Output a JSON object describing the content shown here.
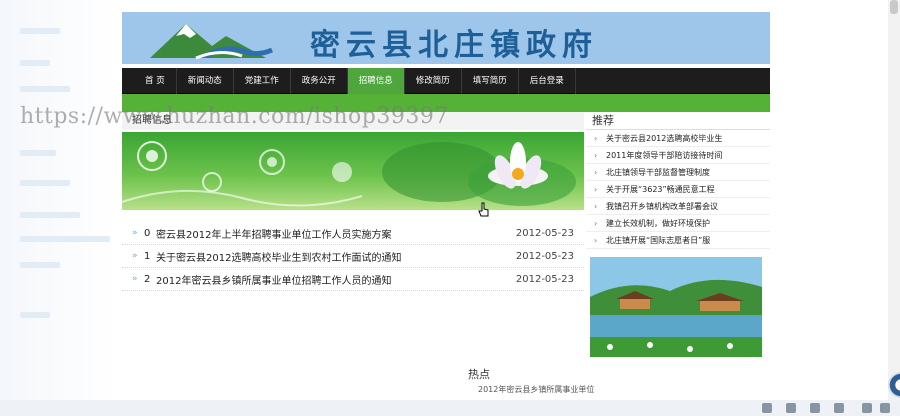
{
  "site_title": "密云县北庄镇政府",
  "nav": [
    {
      "label": "首 页",
      "active": false
    },
    {
      "label": "新闻动态",
      "active": false
    },
    {
      "label": "党建工作",
      "active": false
    },
    {
      "label": "政务公开",
      "active": false
    },
    {
      "label": "招聘信息",
      "active": true
    },
    {
      "label": "修改简历",
      "active": false
    },
    {
      "label": "填写简历",
      "active": false
    },
    {
      "label": "后台登录",
      "active": false
    }
  ],
  "main": {
    "section_title": "招聘信息",
    "news": [
      {
        "index": "0",
        "title": "密云县2012年上半年招聘事业单位工作人员实施方案",
        "date": "2012-05-23"
      },
      {
        "index": "1",
        "title": "关于密云县2012选聘高校毕业生到农村工作面试的通知",
        "date": "2012-05-23"
      },
      {
        "index": "2",
        "title": "2012年密云县乡镇所属事业单位招聘工作人员的通知",
        "date": "2012-05-23"
      }
    ]
  },
  "side": {
    "recommend_title": "推荐",
    "recommend_items": [
      "关于密云县2012选聘高校毕业生",
      "2011年度领导干部陪访接待时间",
      "北庄镇领导干部监督管理制度",
      "关于开展“3623”畅通民意工程",
      "我镇召开乡镇机构改革部署会议",
      "建立长效机制，做好环境保护",
      "北庄镇开展“国际志愿者日”服"
    ],
    "hot_title": "热点",
    "hot_items": [
      "2012年密云县乡镇所属事业单位"
    ]
  },
  "watermark": "https://www.huzhan.com/ishop39397",
  "colors": {
    "nav_bg": "#1d1d1d",
    "nav_active": "#4ea63c",
    "banner_bg": "#9ec6ea",
    "title_blue": "#1f5f98"
  }
}
